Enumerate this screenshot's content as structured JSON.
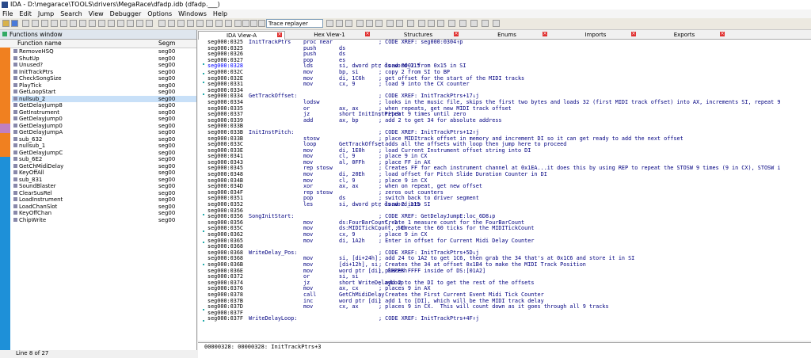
{
  "window": {
    "title": "IDA - D:\\megarace\\TOOLS\\drivers\\MegaRace\\dfadp.idb (dfadp.___)"
  },
  "menu": [
    "File",
    "Edit",
    "Jump",
    "Search",
    "View",
    "Debugger",
    "Options",
    "Windows",
    "Help"
  ],
  "toolbar": {
    "debugger_combo": "Trace replayer"
  },
  "functions_window": {
    "title": "Functions window",
    "col_name": "Function name",
    "col_segment": "Segm",
    "status": "Line 8 of 27",
    "items": [
      {
        "name": "RemoveHSQ",
        "seg": "seg00"
      },
      {
        "name": "ShutUp",
        "seg": "seg00"
      },
      {
        "name": "Unused?",
        "seg": "seg00"
      },
      {
        "name": "InitTrackPtrs",
        "seg": "seg00"
      },
      {
        "name": "CheckSongSize",
        "seg": "seg00"
      },
      {
        "name": "PlayTick",
        "seg": "seg00"
      },
      {
        "name": "GetLoopStart",
        "seg": "seg00"
      },
      {
        "name": "nullsub_2",
        "seg": "seg00"
      },
      {
        "name": "GetDelayJump8",
        "seg": "seg00"
      },
      {
        "name": "GetInstrument",
        "seg": "seg00"
      },
      {
        "name": "GetDelayJump0",
        "seg": "seg00"
      },
      {
        "name": "GetDelayJump0",
        "seg": "seg00"
      },
      {
        "name": "GetDelayJumpA",
        "seg": "seg00"
      },
      {
        "name": "sub_632",
        "seg": "seg00"
      },
      {
        "name": "nullsub_1",
        "seg": "seg00"
      },
      {
        "name": "GetDelayJumpC",
        "seg": "seg00"
      },
      {
        "name": "sub_6E2",
        "seg": "seg00"
      },
      {
        "name": "GetChMidiDelay",
        "seg": "seg00"
      },
      {
        "name": "KeyOffAll",
        "seg": "seg00"
      },
      {
        "name": "sub_831",
        "seg": "seg00"
      },
      {
        "name": "SoundBlaster",
        "seg": "seg00"
      },
      {
        "name": "ClearSusRel",
        "seg": "seg00"
      },
      {
        "name": "LoadInstrument",
        "seg": "seg00"
      },
      {
        "name": "LoadChanSlot",
        "seg": "seg00"
      },
      {
        "name": "KeyOffChan",
        "seg": "seg00"
      },
      {
        "name": "ChipWrite",
        "seg": "seg00"
      }
    ]
  },
  "tabs": [
    "IDA View-A",
    "Hex View-1",
    "Structures",
    "Enums",
    "Imports",
    "Exports"
  ],
  "code_lines": [
    {
      "a": "seg000:0325",
      "l": "InitTrackPtrs",
      "m": "proc near",
      "o": "",
      "c": "; CODE XREF: seg000:0304↑p"
    },
    {
      "a": "seg000:0325",
      "l": "",
      "m": "push",
      "o": "ds",
      "c": ""
    },
    {
      "a": "seg000:0326",
      "l": "",
      "m": "push",
      "o": "ds",
      "c": ""
    },
    {
      "a": "seg000:0327",
      "l": "",
      "m": "pop",
      "o": "es",
      "c": ""
    },
    {
      "a": "seg000:0328",
      "l": "",
      "m": "lds",
      "o": "si, dword ptr ds:word_115",
      "c": "; load 0002 from 0x15 in SI",
      "hl": true
    },
    {
      "a": "seg000:032C",
      "l": "",
      "m": "mov",
      "o": "bp, si",
      "c": "; copy 2 from SI to BP"
    },
    {
      "a": "seg000:032E",
      "l": "",
      "m": "mov",
      "o": "di, 1C6h",
      "c": "; get offset for the start of the MIDI tracks"
    },
    {
      "a": "seg000:0331",
      "l": "",
      "m": "mov",
      "o": "cx, 9",
      "c": "; load 9 into the CX counter"
    },
    {
      "a": "seg000:0334",
      "l": "",
      "m": "",
      "o": "",
      "c": ""
    },
    {
      "a": "seg000:0334",
      "l": "GetTrackOffset:",
      "m": "",
      "o": "",
      "c": "; CODE XREF: InitTrackPtrs+17↓j"
    },
    {
      "a": "seg000:0334",
      "l": "",
      "m": "lodsw",
      "o": "",
      "c": "; looks in the music file, skips the first two bytes and loads 32 (first MIDI track offset) into AX, increments SI, repeat 9"
    },
    {
      "a": "seg000:0335",
      "l": "",
      "m": "or",
      "o": "ax, ax",
      "c": "; when repeats, get new MIDI track offset"
    },
    {
      "a": "seg000:0337",
      "l": "",
      "m": "jz",
      "o": "short InitInstPitch",
      "c": "; repeat 9 times until zero"
    },
    {
      "a": "seg000:0339",
      "l": "",
      "m": "add",
      "o": "ax, bp",
      "c": "; add 2 to get 34 for absolute address"
    },
    {
      "a": "seg000:033B",
      "l": "",
      "m": "",
      "o": "",
      "c": ""
    },
    {
      "a": "seg000:033B",
      "l": "InitInstPitch:",
      "m": "",
      "o": "",
      "c": "; CODE XREF: InitTrackPtrs+12↑j"
    },
    {
      "a": "seg000:033B",
      "l": "",
      "m": "stosw",
      "o": "",
      "c": "; place MIDItrack offset in memory and increment DI so it can get ready to add the next offset"
    },
    {
      "a": "seg000:033C",
      "l": "",
      "m": "loop",
      "o": "GetTrackOffset",
      "c": "; adds all the offsets with loop then jump here to proceed"
    },
    {
      "a": "seg000:033E",
      "l": "",
      "m": "mov",
      "o": "di, 1E0h",
      "c": "; load Current Instrument offset string into DI"
    },
    {
      "a": "seg000:0341",
      "l": "",
      "m": "mov",
      "o": "cl, 9",
      "c": "; place 9 in CX"
    },
    {
      "a": "seg000:0343",
      "l": "",
      "m": "mov",
      "o": "al, 0FFh",
      "c": "; place FF in AX"
    },
    {
      "a": "seg000:0345",
      "l": "",
      "m": "rep stosw",
      "o": "",
      "c": "; Creates FF for each instrument channel at 0x1EA...it does this by using REP to repeat the STOSW 9 times (9 in CX), STOSW i"
    },
    {
      "a": "seg000:0348",
      "l": "",
      "m": "mov",
      "o": "di, 20Eh",
      "c": "; load offset for Pitch Slide Duration Counter in DI"
    },
    {
      "a": "seg000:034B",
      "l": "",
      "m": "mov",
      "o": "cl, 9",
      "c": "; place 9 in CX"
    },
    {
      "a": "seg000:034D",
      "l": "",
      "m": "xor",
      "o": "ax, ax",
      "c": "; when on repeat, get new offset"
    },
    {
      "a": "seg000:034F",
      "l": "",
      "m": "rep stosw",
      "o": "",
      "c": "; zeros out counters"
    },
    {
      "a": "seg000:0351",
      "l": "",
      "m": "pop",
      "o": "ds",
      "c": "; switch back to driver segment"
    },
    {
      "a": "seg000:0352",
      "l": "",
      "m": "les",
      "o": "si, dword ptr ds:word_115",
      "c": "; load 2 into SI"
    },
    {
      "a": "seg000:0356",
      "l": "",
      "m": "",
      "o": "",
      "c": ""
    },
    {
      "a": "seg000:0356",
      "l": "SongInitStart:",
      "m": "",
      "o": "",
      "c": "; CODE XREF: GetDelayJumpE:loc_6D8↓p"
    },
    {
      "a": "seg000:0356",
      "l": "",
      "m": "mov",
      "o": "ds:FourBarCount, 1",
      "c": "; Create 1 measure count for the FourBarCount"
    },
    {
      "a": "seg000:035C",
      "l": "",
      "m": "mov",
      "o": "ds:MIDITickCount, 60h",
      "c": "; `` ; Create the 60 ticks for the MIDITickCount"
    },
    {
      "a": "seg000:0362",
      "l": "",
      "m": "mov",
      "o": "cx, 9",
      "c": "; place 9 in CX"
    },
    {
      "a": "seg000:0365",
      "l": "",
      "m": "mov",
      "o": "di, 1A2h",
      "c": "; Enter in offset for Current Midi Delay Counter"
    },
    {
      "a": "seg000:0368",
      "l": "",
      "m": "",
      "o": "",
      "c": ""
    },
    {
      "a": "seg000:0368",
      "l": "WriteDelay_Pos:",
      "m": "",
      "o": "",
      "c": "; CODE XREF: InitTrackPtrs+5D↓j"
    },
    {
      "a": "seg000:0368",
      "l": "",
      "m": "mov",
      "o": "si, [di+24h]",
      "c": "; add 24 to 1A2 to get 1C6, then grab the 34 that's at 0x1C6 and store it in SI"
    },
    {
      "a": "seg000:036B",
      "l": "",
      "m": "mov",
      "o": "[di+12h], si",
      "c": "; Creates the 34 at offset 0x1B4 to make the MIDI Track Position"
    },
    {
      "a": "seg000:036E",
      "l": "",
      "m": "mov",
      "o": "word ptr [di], 0FFFFh",
      "c": "; places FFFF inside of DS:[01A2]"
    },
    {
      "a": "seg000:0372",
      "l": "",
      "m": "or",
      "o": "si, si",
      "c": ""
    },
    {
      "a": "seg000:0374",
      "l": "",
      "m": "jz",
      "o": "short WriteDelayLoop",
      "c": "; add 2 to the DI to get the rest of the offsets"
    },
    {
      "a": "seg000:0376",
      "l": "",
      "m": "mov",
      "o": "ax, cx",
      "c": "; places 9 in AX"
    },
    {
      "a": "seg000:0378",
      "l": "",
      "m": "call",
      "o": "GetChMidiDelay",
      "c": "; Creates the First Current Event Midi Tick Counter"
    },
    {
      "a": "seg000:037B",
      "l": "",
      "m": "inc",
      "o": "word ptr [di]",
      "c": "; add 1 to [DI], which will be the MIDI track delay"
    },
    {
      "a": "seg000:037D",
      "l": "",
      "m": "mov",
      "o": "cx, ax",
      "c": "; places 9 in CX.  This will count down as it goes through all 9 tracks"
    },
    {
      "a": "seg000:037F",
      "l": "",
      "m": "",
      "o": "",
      "c": ""
    },
    {
      "a": "seg000:037F",
      "l": "WriteDelayLoop:",
      "m": "",
      "o": "",
      "c": "; CODE XREF: InitTrackPtrs+4F↑j"
    }
  ],
  "status_text": "00000328: 00000328: InitTrackPtrs+3",
  "colors": {
    "nav_strip": "#1e90d8",
    "code_text": "#000080",
    "address_highlight": "#0000ff"
  }
}
